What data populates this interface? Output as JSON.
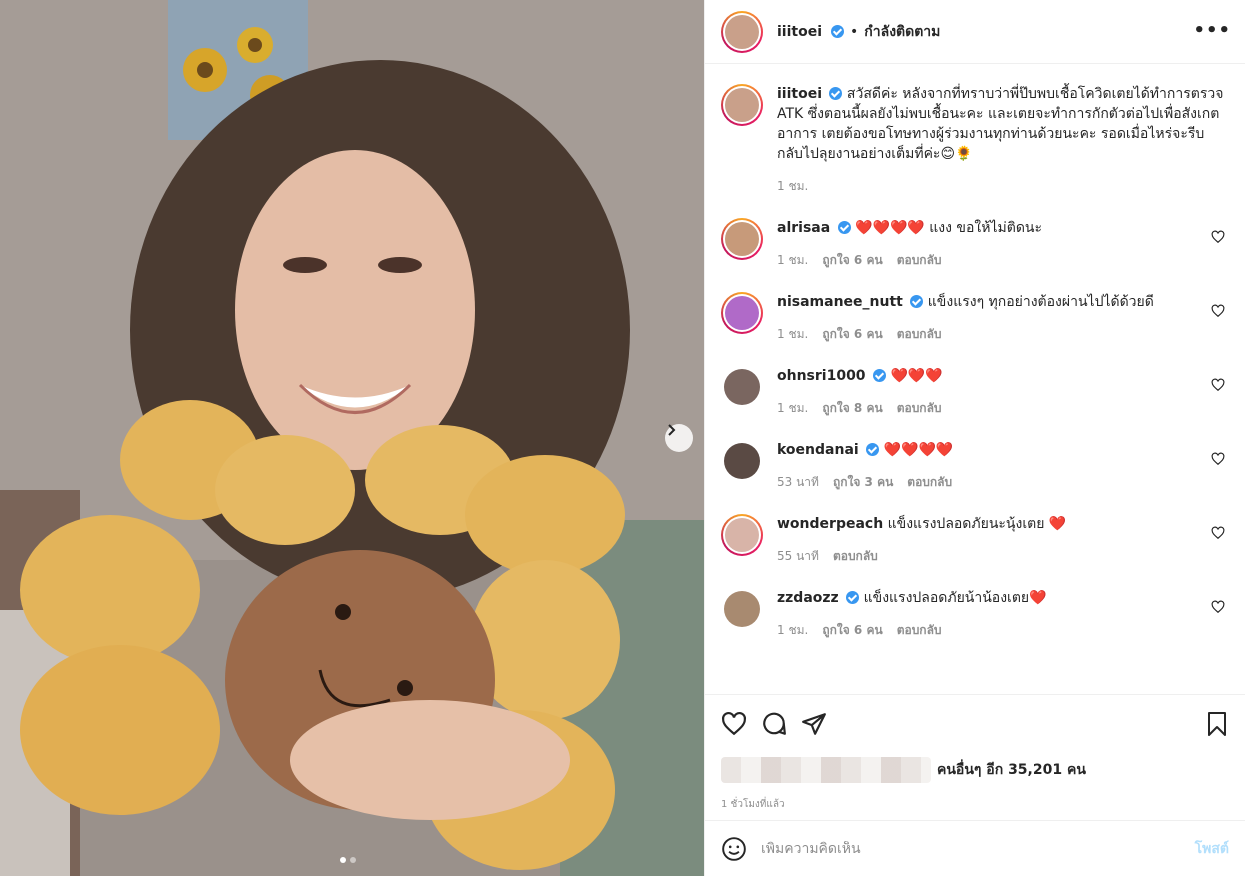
{
  "post": {
    "author": "iiitoei",
    "follow_label": "กำลังติดตาม",
    "more_icon": "more-horizontal-icon",
    "caption": "สวัสดีค่ะ หลังจากที่ทราบว่าพี่ป๊บพบเชื้อโควิดเตยได้ทำการตรวจ ATK ซึ่งตอนนี้ผลยังไม่พบเชื้อนะคะ และเตยจะทำการกักตัวต่อไปเพื่อสังเกตอาการ เตยต้องขอโทษทางผู้ร่วมงานทุกท่านด้วยนะคะ รอดเมื่อไหร่จะรีบกลับไปลุยงานอย่างเต็มที่ค่ะ😊🌻",
    "caption_time": "1 ชม."
  },
  "comments": [
    {
      "user": "alrisaa",
      "verified": true,
      "text": "❤️❤️❤️❤️ แงง ขอให้ไม่ติดนะ",
      "time": "1 ชม.",
      "likes": "ถูกใจ 6 คน",
      "reply": "ตอบกลับ",
      "avatar_color": "#c79a7a"
    },
    {
      "user": "nisamanee_nutt",
      "verified": true,
      "text": "แข็งแรงๆ ทุกอย่างต้องผ่านไปได้ด้วยดี",
      "time": "1 ชม.",
      "likes": "ถูกใจ 6 คน",
      "reply": "ตอบกลับ",
      "avatar_color": "#b06ac8"
    },
    {
      "user": "ohnsri1000",
      "verified": true,
      "text": "❤️❤️❤️",
      "time": "1 ชม.",
      "likes": "ถูกใจ 8 คน",
      "reply": "ตอบกลับ",
      "avatar_color": "#7a6660"
    },
    {
      "user": "koendanai",
      "verified": true,
      "text": "❤️❤️❤️❤️",
      "time": "53 นาที",
      "likes": "ถูกใจ 3 คน",
      "reply": "ตอบกลับ",
      "avatar_color": "#5a4a44"
    },
    {
      "user": "wonderpeach",
      "verified": false,
      "text": "แข็งแรงปลอดภัยนะนุ้งเตย ❤️",
      "time": "55 นาที",
      "likes": "",
      "reply": "ตอบกลับ",
      "avatar_color": "#d8b4a8"
    },
    {
      "user": "zzdaozz",
      "verified": true,
      "text": "แข็งแรงปลอดภัยน้าน้องเตย❤️",
      "time": "1 ชม.",
      "likes": "ถูกใจ 6 คน",
      "reply": "ตอบกลับ",
      "avatar_color": "#a88a70"
    }
  ],
  "actions": {
    "likes_text": "คนอื่นๆ อีก 35,201 คน",
    "posted_time": "1 ชั่วโมงที่แล้ว",
    "comment_placeholder": "เพิ่มความคิดเห็น",
    "post_label": "โพสต์"
  },
  "carousel": {
    "current": 1,
    "total": 2
  },
  "colors": {
    "verified": "#3897f0",
    "heart": "#e0245e",
    "post_button": "#b2dffc"
  }
}
